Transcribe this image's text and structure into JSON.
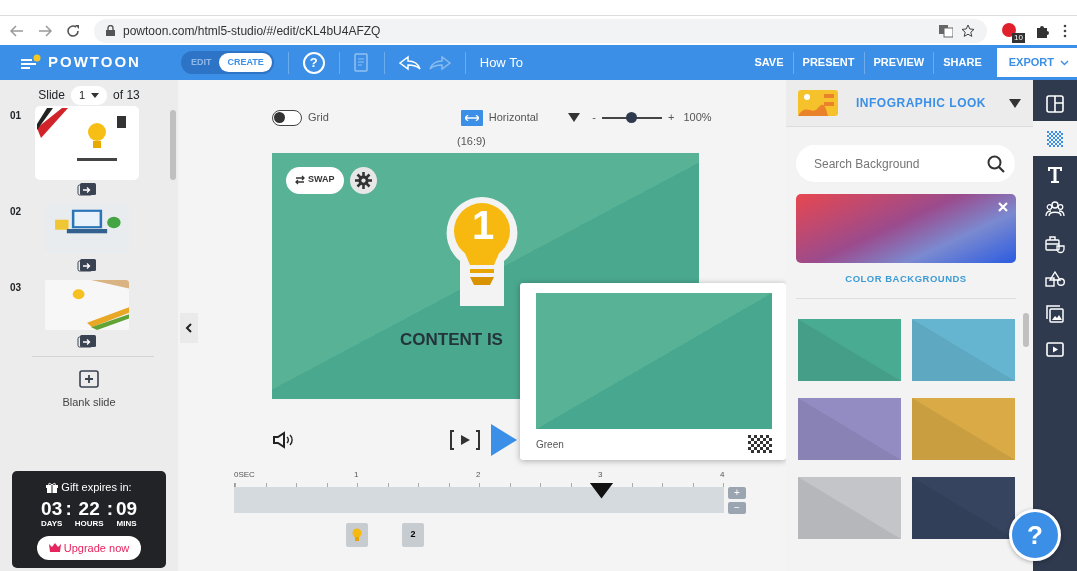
{
  "browser": {
    "url": "powtoon.com/html5-studio/#/edit/cKL4bU4AFZQ",
    "extension_badge": "10"
  },
  "toolbar": {
    "logo": "POWTOON",
    "mode_tabs": [
      {
        "label": "EDIT",
        "selected": false
      },
      {
        "label": "CREATE",
        "selected": true
      }
    ],
    "help": "?",
    "undo_disabled": false,
    "redo_disabled": true,
    "title": "How To",
    "actions": [
      "SAVE",
      "PRESENT",
      "PREVIEW",
      "SHARE"
    ],
    "export": "EXPORT"
  },
  "slides_panel": {
    "label": "Slide",
    "current": "1",
    "total": "of 13",
    "slides": [
      {
        "number": "01",
        "selected": true,
        "kind": "bulb"
      },
      {
        "number": "02",
        "selected": false,
        "kind": "laptop"
      },
      {
        "number": "03",
        "selected": false,
        "kind": "pencils"
      }
    ],
    "blank_slide": "Blank slide",
    "gift": {
      "title": "Gift expires in:",
      "separator": ":",
      "units": [
        {
          "value": "03",
          "label": "DAYS"
        },
        {
          "value": "22",
          "label": "HOURS"
        },
        {
          "value": "09",
          "label": "MINS"
        }
      ],
      "upgrade": "Upgrade now"
    }
  },
  "canvas": {
    "grid": {
      "label": "Grid",
      "on": false
    },
    "orientation": "Horizontal",
    "zoom": {
      "minus": "-",
      "level": 0.5,
      "plus": "+",
      "reading": "100%"
    },
    "aspect": "(16:9)",
    "slide": {
      "swap": "SWAP",
      "bulb_number": "1",
      "heading": "CONTENT IS"
    },
    "preview_popup": {
      "label": "Green"
    }
  },
  "timeline": {
    "ticks": [
      "0SEC",
      "1",
      "2",
      "3",
      "4"
    ],
    "playhead": {
      "level": 0.75
    },
    "zoom_in": "+",
    "zoom_out": "−",
    "markers": [
      {
        "kind": "bulb"
      },
      {
        "kind": "text",
        "label": "2"
      }
    ]
  },
  "right_panel": {
    "category": "INFOGRAPHIC LOOK",
    "search": {
      "placeholder": "Search Background"
    },
    "section": "COLOR BACKGROUNDS",
    "swatches": [
      {
        "color": "#4aab93"
      },
      {
        "color": "#66b5d0"
      },
      {
        "color": "#938cc3"
      },
      {
        "color": "#d9aa45"
      },
      {
        "color": "#c4c5c9"
      },
      {
        "color": "#36445f"
      }
    ]
  },
  "side_tools": [
    {
      "kind": "layout",
      "selected": false
    },
    {
      "kind": "backgrounds",
      "selected": true
    },
    {
      "kind": "text",
      "selected": false
    },
    {
      "kind": "characters",
      "selected": false
    },
    {
      "kind": "props",
      "selected": false
    },
    {
      "kind": "shapes",
      "selected": false
    },
    {
      "kind": "media",
      "selected": false
    },
    {
      "kind": "video",
      "selected": false
    }
  ],
  "help_fab": "?"
}
